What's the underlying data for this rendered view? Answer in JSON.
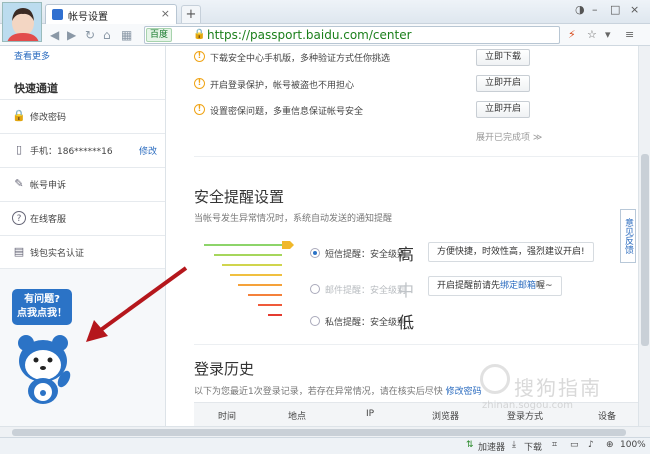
{
  "browser": {
    "tab_title": "帐号设置",
    "tab_close": "×",
    "new_tab": "+",
    "url_badge": "百度",
    "url": "https://passport.baidu.com/center",
    "window_controls": [
      "–",
      "□",
      "×"
    ]
  },
  "sidebar": {
    "more_link": "查看更多",
    "quick_title": "快速通道",
    "items": [
      {
        "label": "修改密码",
        "icon": "lock-icon"
      },
      {
        "label": "手机：186******16",
        "action": "修改",
        "icon": "phone-icon"
      },
      {
        "label": "帐号申诉",
        "icon": "appeal-icon"
      },
      {
        "label": "在线客服",
        "icon": "help-icon"
      },
      {
        "label": "钱包实名认证",
        "icon": "id-card-icon"
      }
    ],
    "help_bubble": [
      "有问题?",
      "点我点我！"
    ]
  },
  "tasks": [
    {
      "text": "下载安全中心手机版，多种验证方式任你挑选",
      "button": "立即下载"
    },
    {
      "text": "开启登录保护，帐号被盗也不用担心",
      "button": "立即开启"
    },
    {
      "text": "设置密保问题，多重信息保证帐号安全",
      "button": "立即开启"
    }
  ],
  "expand_link": "展开已完成项 ≫",
  "alert_settings": {
    "title": "安全提醒设置",
    "description": "当帐号发生异常情况时，系统自动发送的通知提醒",
    "options": [
      {
        "label": "短信提醒：安全级别",
        "level": "高",
        "selected": true,
        "callout": "方便快捷，时效性高，强烈建议开启!"
      },
      {
        "label": "邮件提醒：安全级别",
        "level": "中",
        "selected": false,
        "callout_pre": "开启提醒前请先",
        "callout_link": "绑定邮箱",
        "callout_post": "喔~"
      },
      {
        "label": "私信提醒：安全级别",
        "level": "低",
        "selected": false
      }
    ]
  },
  "history": {
    "title": "登录历史",
    "description": "以下为您最近1次登录记录，若存在异常情况，请在核实后尽快",
    "description_link": "修改密码",
    "columns": [
      "时间",
      "地点",
      "IP",
      "浏览器",
      "登录方式",
      "设备"
    ]
  },
  "feedback_tab": "意见反馈",
  "statusbar": {
    "accelerator": "加速器",
    "download": "下载",
    "zoom": "100%"
  },
  "watermark": {
    "text": "搜狗指南",
    "sub": "zhinan.sogou.com"
  },
  "colors": {
    "link": "#2a6bbf",
    "accent": "#2b73c6",
    "warning": "#f0a416",
    "arrow": "#b5171c"
  }
}
